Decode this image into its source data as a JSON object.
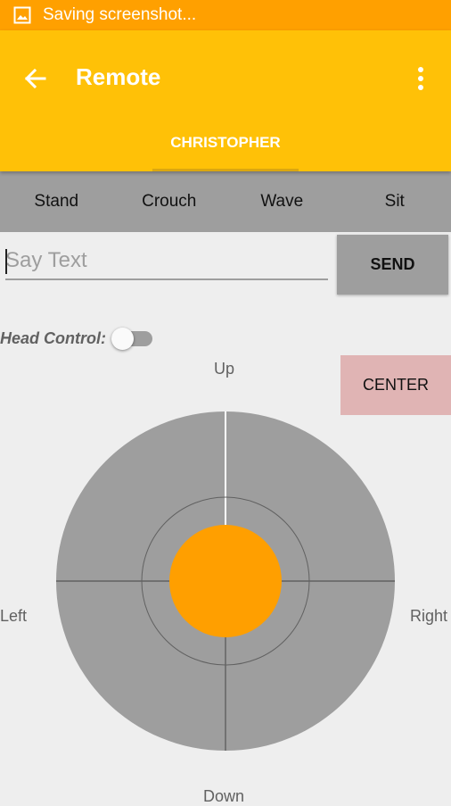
{
  "status_bar": {
    "text": "Saving screenshot...",
    "icon": "image-icon"
  },
  "app_bar": {
    "title": "Remote",
    "back_icon": "arrow-back-icon",
    "menu_icon": "more-vert-icon"
  },
  "tabs": [
    {
      "label": "CHRISTOPHER",
      "selected": true
    }
  ],
  "poses": [
    "Stand",
    "Crouch",
    "Wave",
    "Sit"
  ],
  "say": {
    "placeholder": "Say Text",
    "value": "",
    "send_label": "SEND"
  },
  "head_control": {
    "label": "Head Control:",
    "enabled": false
  },
  "center_label": "CENTER",
  "directions": {
    "up": "Up",
    "down": "Down",
    "left": "Left",
    "right": "Right"
  },
  "joystick": {
    "knob_x": 0,
    "knob_y": 0
  },
  "colors": {
    "status_bar": "#ffa000",
    "app_bar": "#ffc107",
    "pose_bar": "#9e9e9e",
    "center_button": "#e0b4b4",
    "joystick": "#9e9e9e",
    "knob": "#ff9f00"
  }
}
